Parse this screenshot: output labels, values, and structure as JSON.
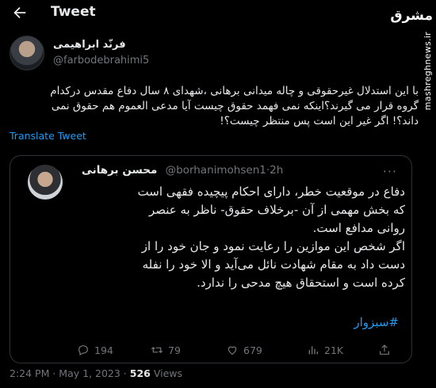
{
  "header": {
    "title": "Tweet",
    "back_icon": "arrow-left-icon"
  },
  "watermark": {
    "logo": "مشرق",
    "url": "mashreghnews.ir"
  },
  "author": {
    "name": "فرنّد ابراهیمی",
    "handle": "@farbodebrahimi5"
  },
  "tweet": {
    "lines": [
      "با این استدلال غیرحقوقی و چاله میدانی برهانی ،شهدای ۸ سال دفاع مقدس درکدام",
      "گروه قرار می گیرند؟اینکه نمی فهمد حقوق چیست آیا مدعی العموم هم حقوق نمی",
      "داند؟! اگر غیر این است پس منتظر چیست؟!"
    ],
    "translate_label": "Translate Tweet"
  },
  "quote": {
    "name": "محسن برهانی",
    "handle": "@borhanimohsen1",
    "separator": "·",
    "time": "2h",
    "more_icon": "more-dots-icon",
    "lines": [
      "دفاع در موقعیت خطر، دارای احکام پیچیده فقهی است",
      "که بخش مهمی از آن -برخلاف حقوق- ناظر به عنصر",
      "روانی مدافع است.",
      "اگر شخص این موازین را رعایت نمود و جان خود را از",
      "دست داد به مقام شهادت نائل می‌آید و الا خود را نفله",
      "کرده است و استحقاق هیچ مدحی را ندارد."
    ],
    "hashtag": "#سبزوار",
    "actions": [
      {
        "icon": "reply-icon",
        "count": "194"
      },
      {
        "icon": "retweet-icon",
        "count": "79"
      },
      {
        "icon": "heart-icon",
        "count": "679"
      },
      {
        "icon": "views-icon",
        "count": "21K"
      },
      {
        "icon": "share-icon",
        "count": ""
      }
    ]
  },
  "meta": {
    "timestamp": "2:24 PM · May 1, 2023",
    "separator": " · ",
    "views_count": "526",
    "views_label": " Views"
  }
}
